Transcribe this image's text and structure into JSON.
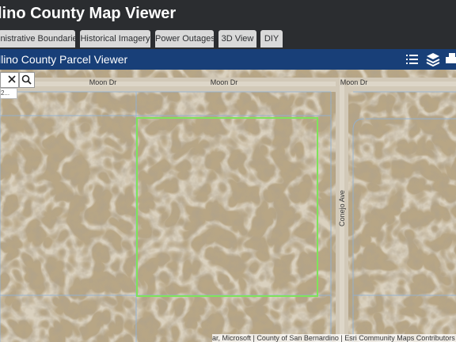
{
  "header": {
    "title": "lino County Map Viewer"
  },
  "tabs": [
    {
      "label": "inistrative Boundaries"
    },
    {
      "label": "Historical Imagery"
    },
    {
      "label": "Power Outages"
    },
    {
      "label": "3D View"
    },
    {
      "label": "DIY"
    }
  ],
  "viewer": {
    "title": "llino County Parcel Viewer"
  },
  "search": {
    "suggestion": "2..."
  },
  "map": {
    "road_labels": [
      "Moon Dr",
      "Moon Dr",
      "Moon Dr",
      "Conejo Ave"
    ],
    "attribution": "ar, Microsoft | County of San Bernardino | Esri Community Maps Contributors"
  },
  "colors": {
    "topbar": "#2b2d30",
    "viewerbar": "#183f78",
    "tab_bg": "#d9d9d9",
    "parcel_highlight": "#7fe35a",
    "parcel_lines": "#8fb3d9",
    "terrain": "#b9a98a"
  }
}
